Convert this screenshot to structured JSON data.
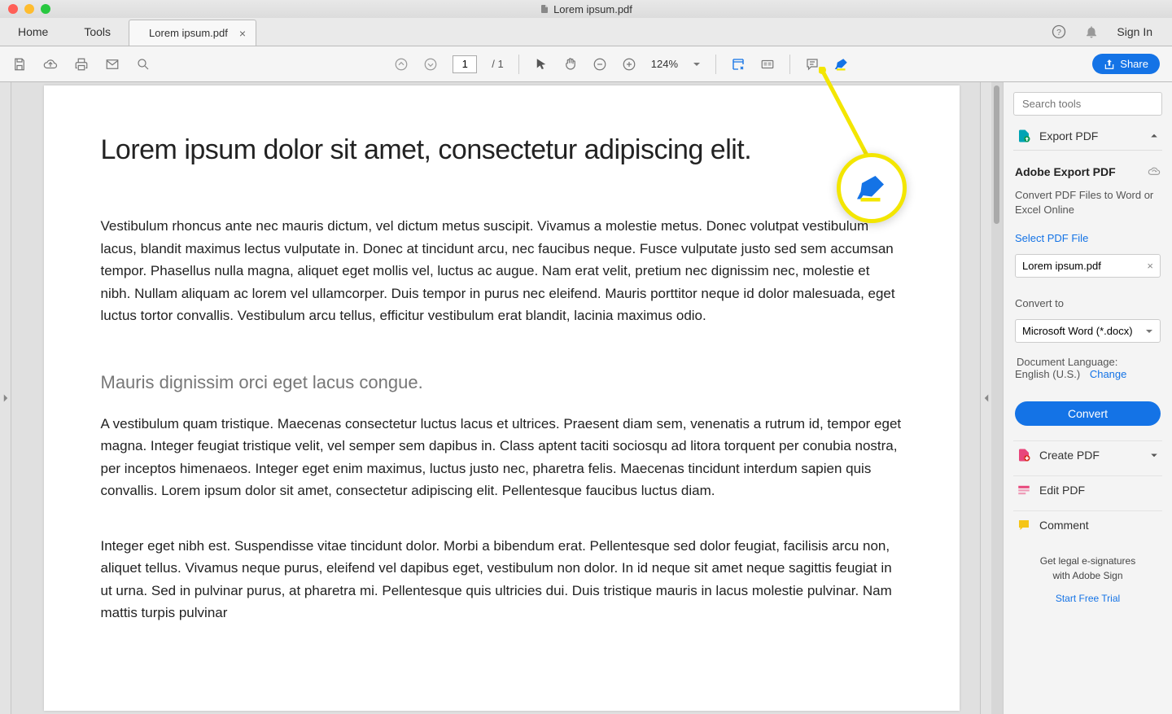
{
  "titlebar": {
    "filename": "Lorem ipsum.pdf"
  },
  "tabs": {
    "home": "Home",
    "tools": "Tools",
    "file": "Lorem ipsum.pdf"
  },
  "header": {
    "signin": "Sign In"
  },
  "toolbar": {
    "page_current": "1",
    "page_sep": "/ 1",
    "zoom": "124%",
    "share": "Share"
  },
  "doc": {
    "h1": "Lorem ipsum dolor sit amet, consectetur adipiscing elit.",
    "p1": "Vestibulum rhoncus ante nec mauris dictum, vel dictum metus suscipit. Vivamus a molestie metus. Donec volutpat vestibulum lacus, blandit maximus lectus vulputate in. Donec at tincidunt arcu, nec faucibus neque. Fusce vulputate justo sed sem accumsan tempor. Phasellus nulla magna, aliquet eget mollis vel, luctus ac augue. Nam erat velit, pretium nec dignissim nec, molestie et nibh. Nullam aliquam ac lorem vel ullamcorper. Duis tempor in purus nec eleifend. Mauris porttitor neque id dolor malesuada, eget luctus tortor convallis. Vestibulum arcu tellus, efficitur vestibulum erat blandit, lacinia maximus odio.",
    "h2": "Mauris dignissim orci eget lacus congue.",
    "p2": "A vestibulum quam tristique. Maecenas consectetur luctus lacus et ultrices. Praesent diam sem, venenatis a rutrum id, tempor eget magna. Integer feugiat tristique velit, vel semper sem dapibus in. Class aptent taciti sociosqu ad litora torquent per conubia nostra, per inceptos himenaeos. Integer eget enim maximus, luctus justo nec, pharetra felis. Maecenas tincidunt interdum sapien quis convallis. Lorem ipsum dolor sit amet, consectetur adipiscing elit. Pellentesque faucibus luctus diam.",
    "p3": "Integer eget nibh est. Suspendisse vitae tincidunt dolor. Morbi a bibendum erat. Pellentesque sed dolor feugiat, facilisis arcu non, aliquet tellus. Vivamus neque purus, eleifend vel dapibus eget, vestibulum non dolor. In id neque sit amet neque sagittis feugiat in ut urna. Sed in pulvinar purus, at pharetra mi. Pellentesque quis ultricies dui. Duis tristique mauris in lacus molestie pulvinar. Nam mattis turpis pulvinar"
  },
  "rpanel": {
    "search_placeholder": "Search tools",
    "export_label": "Export PDF",
    "adobe_export": "Adobe Export PDF",
    "adobe_export_desc": "Convert PDF Files to Word or Excel Online",
    "select_pdf": "Select PDF File",
    "selected_file": "Lorem ipsum.pdf",
    "convert_to": "Convert to",
    "convert_target": "Microsoft Word (*.docx)",
    "doc_lang_label": "Document Language:",
    "doc_lang_value": "English (U.S.)",
    "change": "Change",
    "convert": "Convert",
    "create_pdf": "Create PDF",
    "edit_pdf": "Edit PDF",
    "comment": "Comment",
    "esign1": "Get legal e-signatures",
    "esign2": "with Adobe Sign",
    "trial": "Start Free Trial"
  }
}
